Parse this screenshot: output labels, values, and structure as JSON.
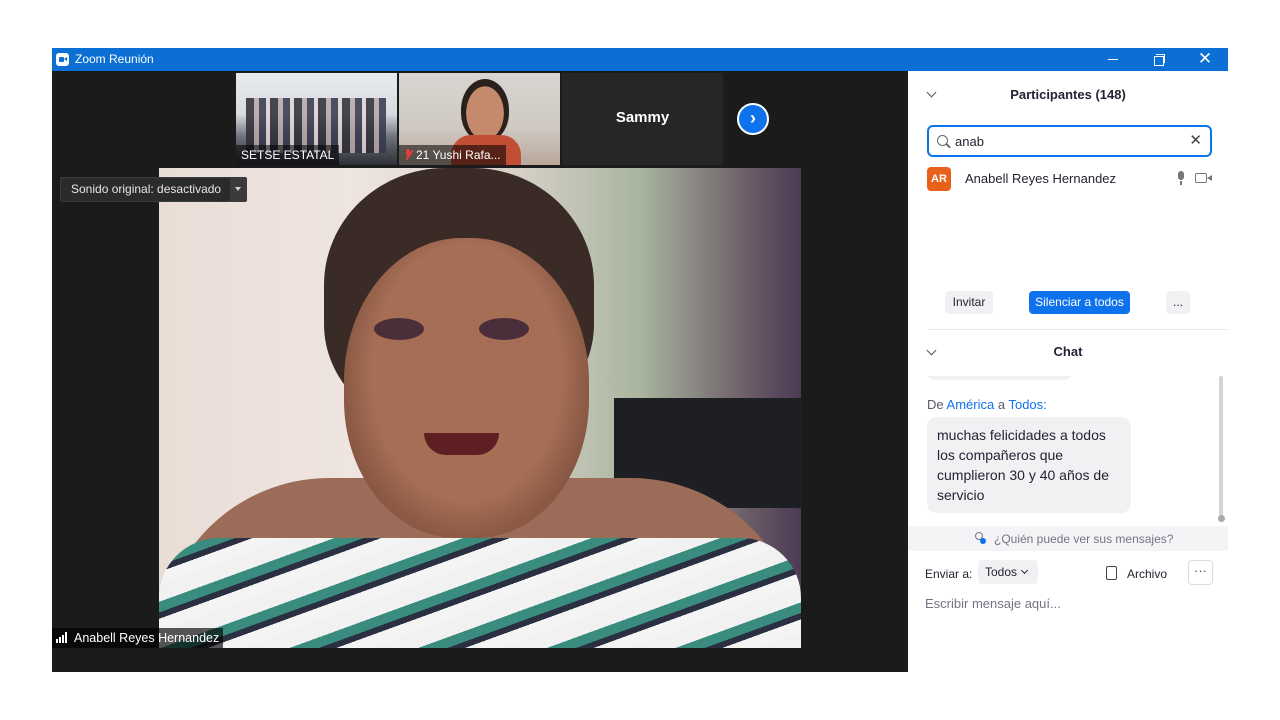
{
  "window": {
    "title": "Zoom Reunión",
    "controls": {
      "minimize": "minimize",
      "restore": "restore",
      "close": "✕"
    }
  },
  "video": {
    "thumbnails": [
      {
        "name": "SETSE ESTATAL",
        "muted": false
      },
      {
        "name": "21 Yushi Rafa...",
        "muted": true
      },
      {
        "name": "Sammy",
        "video_off": true
      }
    ],
    "next_button": "›",
    "sound_label": "Sonido original: desactivado",
    "active_speaker": "Anabell Reyes Hernandez"
  },
  "participants": {
    "title": "Participantes (148)",
    "search_value": "anab",
    "clear": "✕",
    "list": [
      {
        "initials": "AR",
        "name": "Anabell Reyes Hernandez",
        "avatar_color": "#e8601a"
      }
    ],
    "buttons": {
      "invite": "Invitar",
      "mute_all": "Silenciar a todos",
      "more": "..."
    }
  },
  "chat": {
    "title": "Chat",
    "message": {
      "prefix": "De",
      "sender": "América",
      "connector": "a",
      "recipient": "Todos:",
      "text": "muchas felicidades a todos los compañeros que cumplieron 30 y 40 años de servicio"
    },
    "who_can_see": "¿Quién puede ver sus mensajes?",
    "send_to_label": "Enviar a:",
    "send_to_value": "Todos",
    "file_label": "Archivo",
    "more": "···",
    "input_placeholder": "Escribir mensaje aquí..."
  },
  "colors": {
    "title_bar": "#0b6fd4",
    "accent": "#0e72ed",
    "avatar": "#e8601a",
    "video_bg": "#1b1b1b"
  }
}
